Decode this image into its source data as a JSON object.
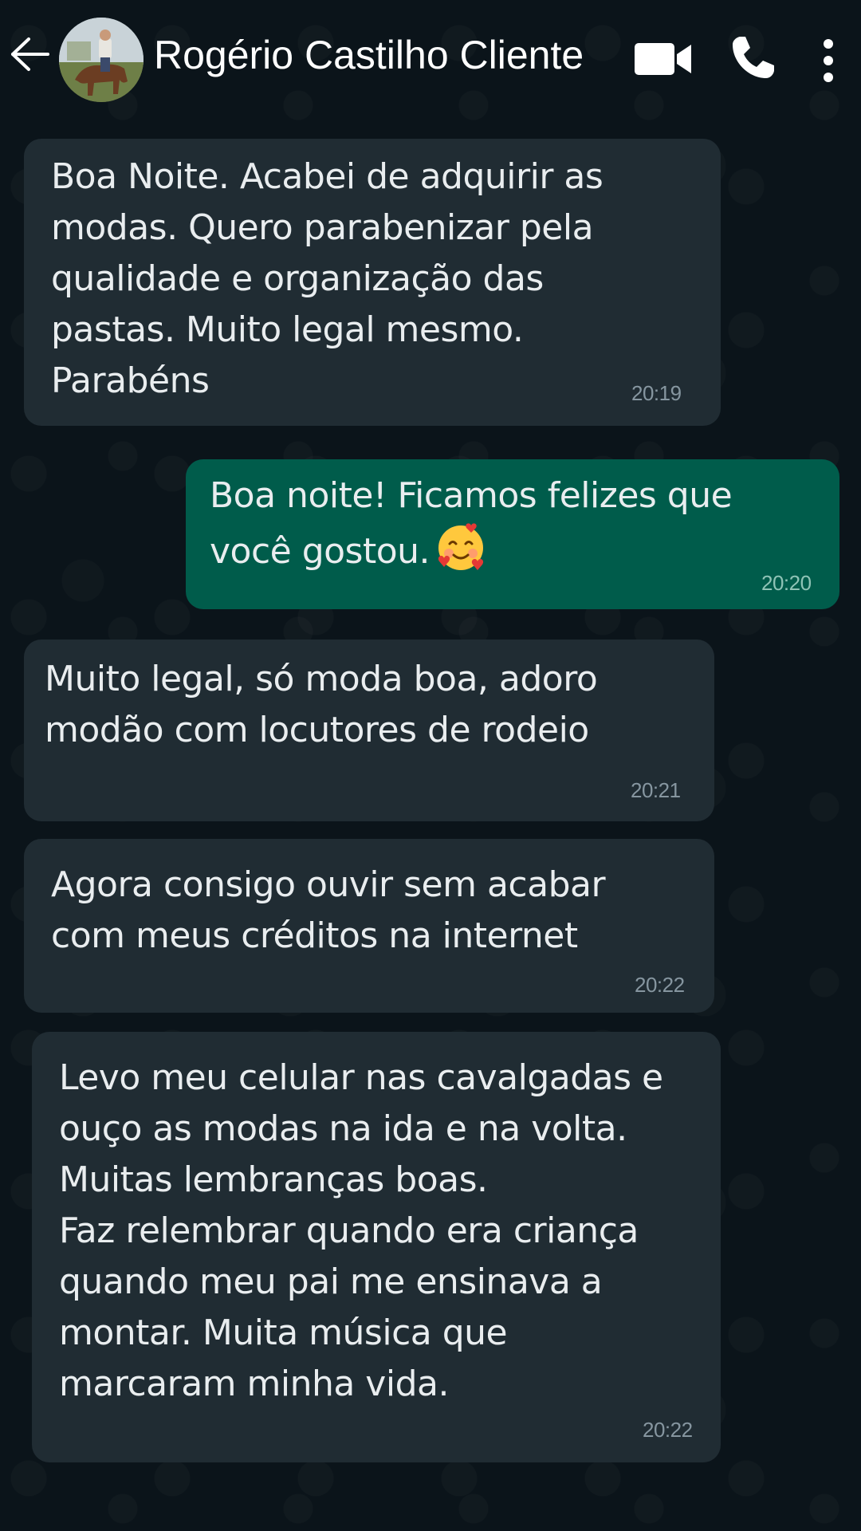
{
  "header": {
    "contact_name": "Rogério Castilho Cliente",
    "back_icon": "arrow-left-icon",
    "video_icon": "video-camera-icon",
    "call_icon": "phone-icon",
    "menu_icon": "more-vertical-icon"
  },
  "colors": {
    "background": "#0b141a",
    "incoming_bubble": "#202c33",
    "outgoing_bubble": "#005c4b",
    "text": "#e9edef",
    "timestamp": "#8696a0"
  },
  "messages": [
    {
      "direction": "incoming",
      "text": "Boa Noite. Acabei de adquirir as\nmodas. Quero parabenizar pela\nqualidade e organização das\npastas. Muito legal mesmo.\nParabéns",
      "time": "20:19"
    },
    {
      "direction": "outgoing",
      "text": "Boa noite! Ficamos felizes que\nvocê gostou.",
      "emoji": "smiling-face-with-hearts",
      "time": "20:20"
    },
    {
      "direction": "incoming",
      "text": "Muito legal, só moda boa, adoro\nmodão com locutores de rodeio",
      "time": "20:21"
    },
    {
      "direction": "incoming",
      "text": "Agora consigo ouvir sem acabar\ncom meus créditos na internet",
      "time": "20:22"
    },
    {
      "direction": "incoming",
      "text": "Levo meu celular nas cavalgadas e\nouço as modas na ida e na volta.\nMuitas lembranças boas.\nFaz relembrar quando era criança\nquando meu pai me ensinava a\nmontar. Muita música que\nmarcaram minha vida.",
      "time": "20:22"
    }
  ]
}
